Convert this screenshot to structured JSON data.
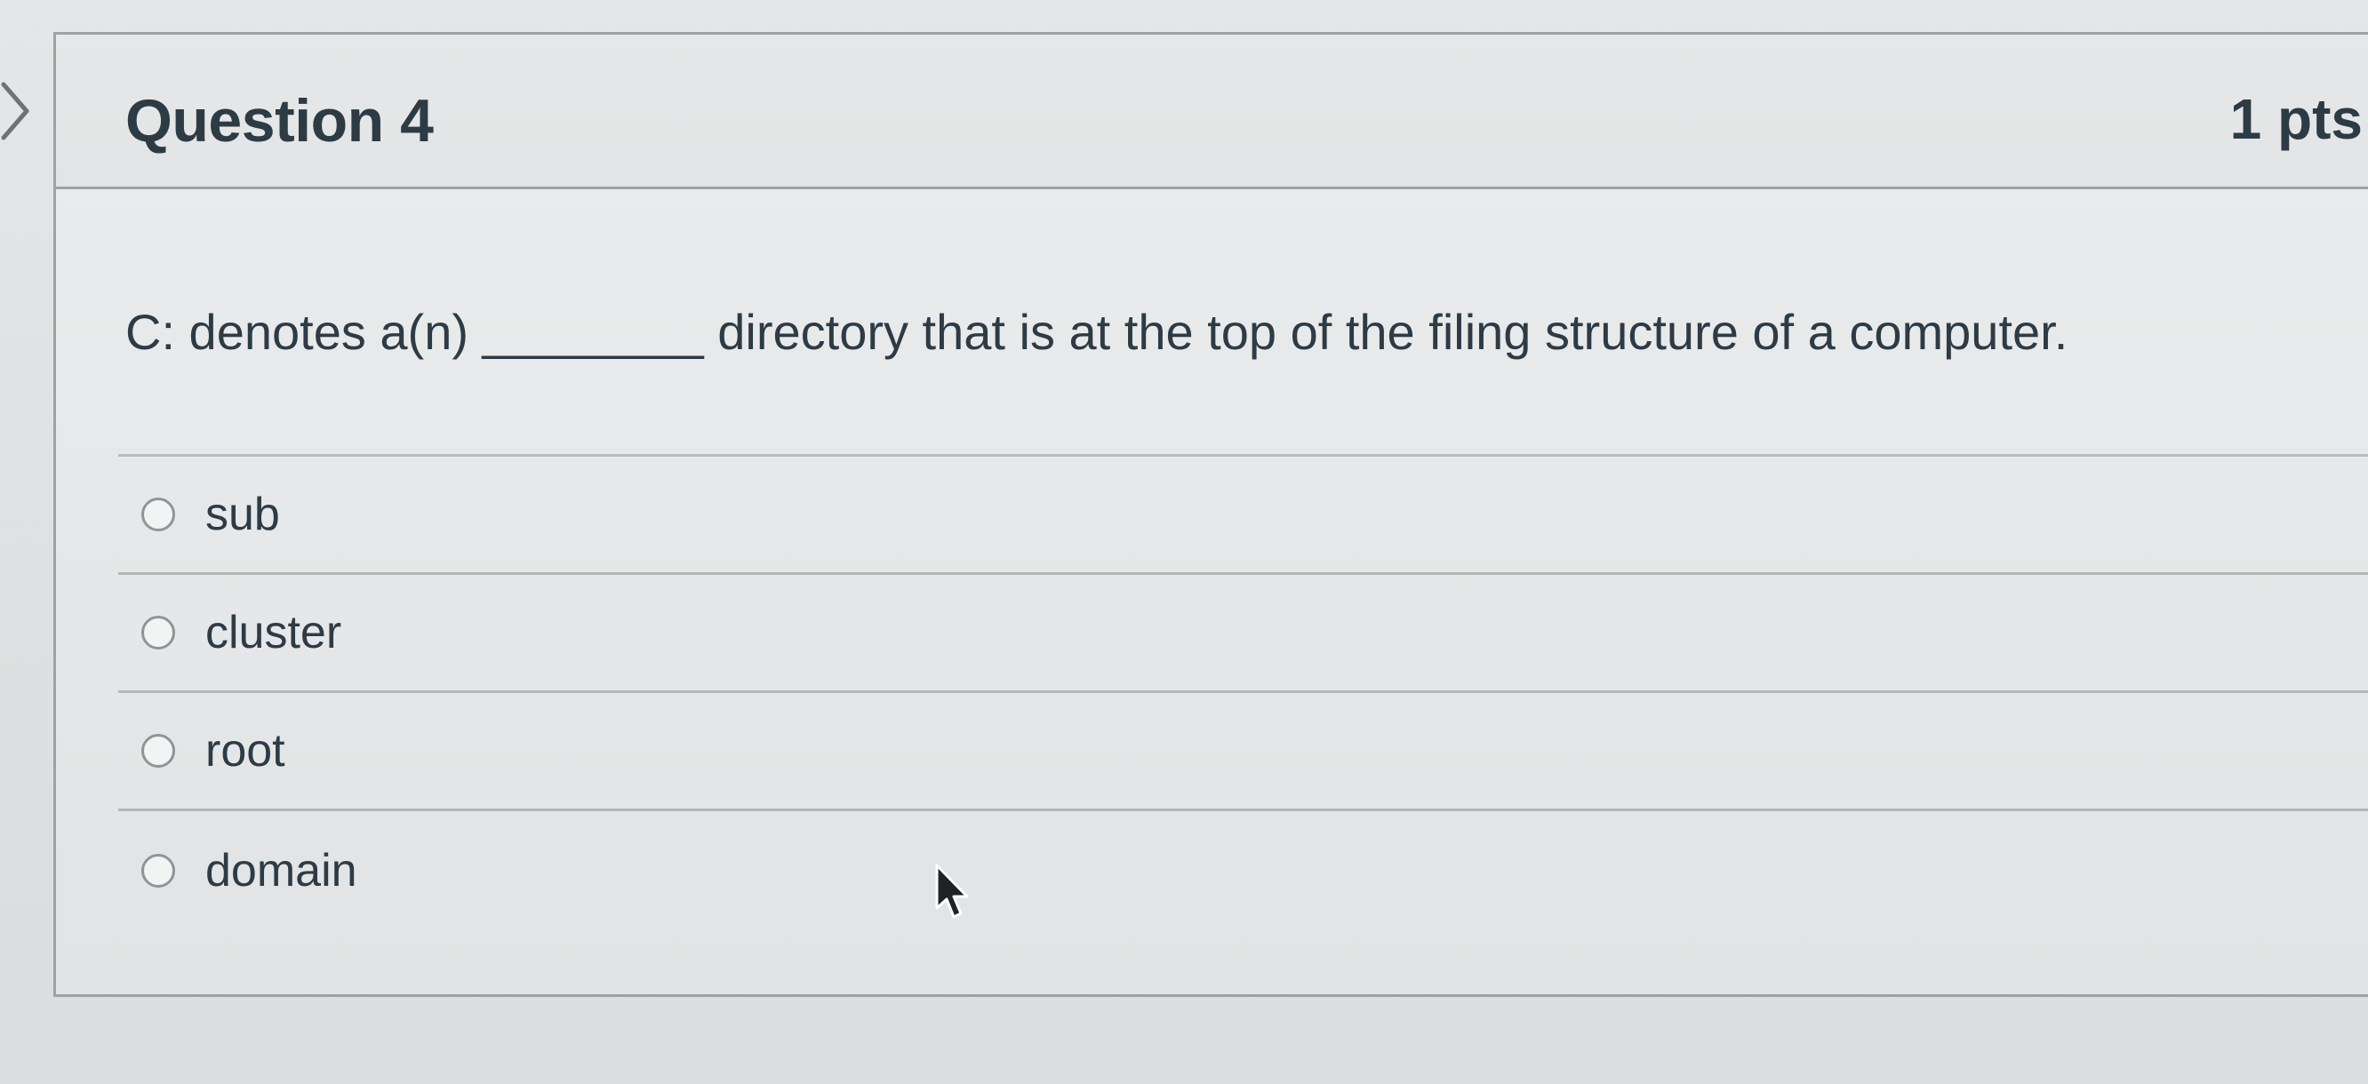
{
  "question": {
    "title": "Question 4",
    "points": "1 pts",
    "text": "C: denotes a(n) ________ directory that is at the top of the filing structure of a computer."
  },
  "answers": [
    {
      "label": "sub",
      "selected": false
    },
    {
      "label": "cluster",
      "selected": false
    },
    {
      "label": "root",
      "selected": false
    },
    {
      "label": "domain",
      "selected": false
    }
  ],
  "icons": {
    "collapse": "chevron-right-icon",
    "radio": "radio-button-unselected",
    "cursor": "mouse-pointer-icon"
  },
  "colors": {
    "text": "#2d3b45",
    "border": "#9ea2a5",
    "background": "#e4e6e7"
  }
}
